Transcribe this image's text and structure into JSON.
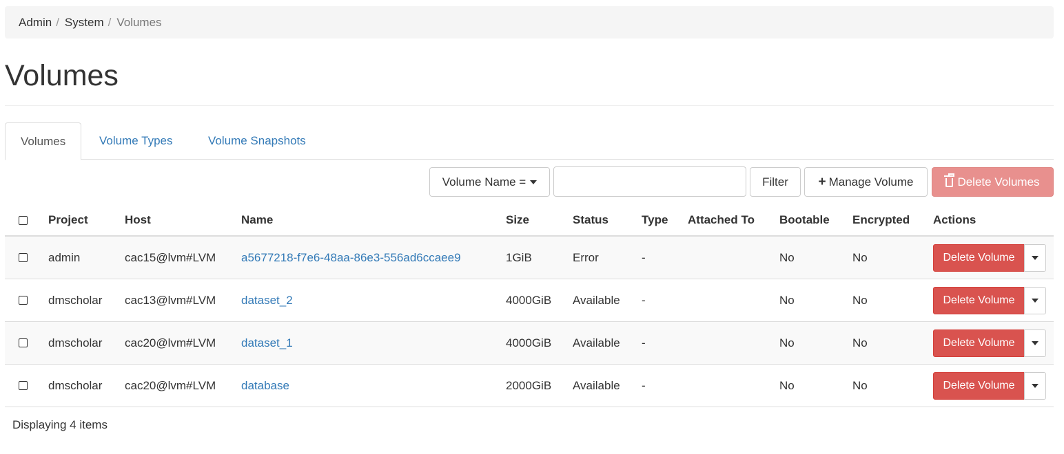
{
  "breadcrumb": {
    "items": [
      "Admin",
      "System"
    ],
    "current": "Volumes"
  },
  "page_title": "Volumes",
  "tabs": [
    {
      "label": "Volumes",
      "active": true
    },
    {
      "label": "Volume Types",
      "active": false
    },
    {
      "label": "Volume Snapshots",
      "active": false
    }
  ],
  "toolbar": {
    "filter_field_label": "Volume Name =",
    "filter_input_value": "",
    "filter_button_label": "Filter",
    "manage_button_label": "Manage Volume",
    "delete_volumes_label": "Delete Volumes"
  },
  "table": {
    "columns": [
      "Project",
      "Host",
      "Name",
      "Size",
      "Status",
      "Type",
      "Attached To",
      "Bootable",
      "Encrypted",
      "Actions"
    ],
    "rows": [
      {
        "project": "admin",
        "host": "cac15@lvm#LVM",
        "name": "a5677218-f7e6-48aa-86e3-556ad6ccaee9",
        "size": "1GiB",
        "status": "Error",
        "type": "-",
        "attached_to": "",
        "bootable": "No",
        "encrypted": "No",
        "action": "Delete Volume"
      },
      {
        "project": "dmscholar",
        "host": "cac13@lvm#LVM",
        "name": "dataset_2",
        "size": "4000GiB",
        "status": "Available",
        "type": "-",
        "attached_to": "",
        "bootable": "No",
        "encrypted": "No",
        "action": "Delete Volume"
      },
      {
        "project": "dmscholar",
        "host": "cac20@lvm#LVM",
        "name": "dataset_1",
        "size": "4000GiB",
        "status": "Available",
        "type": "-",
        "attached_to": "",
        "bootable": "No",
        "encrypted": "No",
        "action": "Delete Volume"
      },
      {
        "project": "dmscholar",
        "host": "cac20@lvm#LVM",
        "name": "database",
        "size": "2000GiB",
        "status": "Available",
        "type": "-",
        "attached_to": "",
        "bootable": "No",
        "encrypted": "No",
        "action": "Delete Volume"
      }
    ]
  },
  "footer": {
    "count_text": "Displaying 4 items"
  },
  "colors": {
    "link": "#337ab7",
    "danger": "#d9534f",
    "danger_disabled": "#e8908e",
    "stripe": "#f9f9f9"
  },
  "icons": {
    "manage": "plus-icon",
    "delete": "trash-icon",
    "dropdown": "caret-down-icon"
  }
}
